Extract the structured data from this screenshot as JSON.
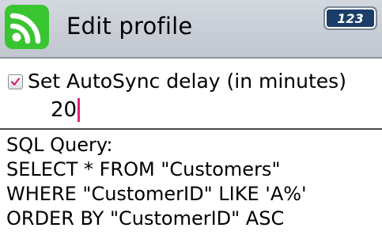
{
  "header": {
    "title": "Edit profile",
    "app_icon": "rss-feed-icon",
    "input_mode": "123",
    "colors": {
      "header_bg": "#c9cdd4",
      "app_icon_bg": "#39c431",
      "badge_bg": "#1b3d69"
    }
  },
  "autosync": {
    "checked": true,
    "label": "Set AutoSync delay (in minutes)",
    "value": "20",
    "caret_color": "#e0207f"
  },
  "sql": {
    "heading": "SQL Query:",
    "lines": [
      "SELECT * FROM \"Customers\"",
      "WHERE \"CustomerID\" LIKE 'A%'",
      "ORDER BY \"CustomerID\" ASC"
    ]
  }
}
